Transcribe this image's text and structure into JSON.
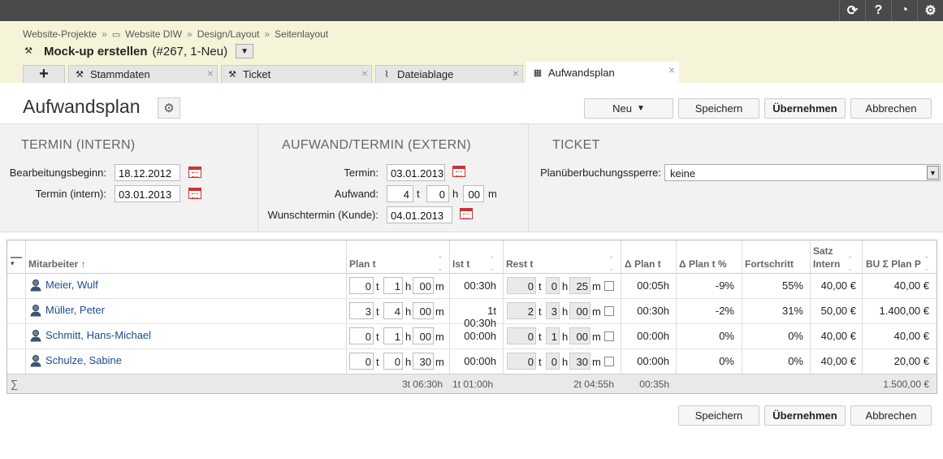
{
  "topbar": {
    "icons": [
      "refresh-icon",
      "help-icon",
      "timer-icon",
      "settings-icon"
    ],
    "help_glyph": "?"
  },
  "breadcrumb": [
    "Website-Projekte",
    "Website DIW",
    "Design/Layout",
    "Seitenlayout"
  ],
  "ticket": {
    "title": "Mock-up erstellen",
    "meta": "(#267, 1-Neu)"
  },
  "tabs": {
    "plus": "+",
    "items": [
      "Stammdaten",
      "Ticket",
      "Dateiablage",
      "Aufwandsplan"
    ],
    "close": "×"
  },
  "page": {
    "title": "Aufwandsplan"
  },
  "buttons": {
    "neu": "Neu",
    "speichern": "Speichern",
    "uebernehmen": "Übernehmen",
    "abbrechen": "Abbrechen"
  },
  "termin_intern": {
    "heading": "TERMIN (INTERN)",
    "bearbeitungsbeginn_label": "Bearbeitungsbeginn:",
    "bearbeitungsbeginn": "18.12.2012",
    "termin_label": "Termin (intern):",
    "termin": "03.01.2013"
  },
  "aufwand_extern": {
    "heading": "AUFWAND/TERMIN (EXTERN)",
    "termin_label": "Termin:",
    "termin": "03.01.2013",
    "aufwand_label": "Aufwand:",
    "aufwand_t": "4",
    "aufwand_h": "0",
    "aufwand_m": "00",
    "wunsch_label": "Wunschtermin (Kunde):",
    "wunsch": "04.01.2013"
  },
  "units": {
    "t": "t",
    "h": "h",
    "m": "m"
  },
  "ticket_panel": {
    "heading": "TICKET",
    "sperre_label": "Planüberbuchungssperre:",
    "sperre_value": "keine"
  },
  "grid": {
    "headers": {
      "mitarbeiter": "Mitarbeiter",
      "plan": "Plan t",
      "ist": "Ist t",
      "rest": "Rest t",
      "dplan": "Δ Plan t",
      "dplanp": "Δ Plan t %",
      "fortschritt": "Fortschritt",
      "satz1": "Satz",
      "satz2": "Intern",
      "bu": "BU Σ Plan P"
    },
    "rows": [
      {
        "name": "Meier, Wulf",
        "plan_t": "0",
        "plan_h": "1",
        "plan_m": "00",
        "ist": "00:30h",
        "rest_t": "0",
        "rest_h": "0",
        "rest_m": "25",
        "dplan": "00:05h",
        "dplanp": "-9%",
        "fortschritt": "55%",
        "satz": "40,00 €",
        "bu": "40,00 €"
      },
      {
        "name": "Müller, Peter",
        "plan_t": "3",
        "plan_h": "4",
        "plan_m": "00",
        "ist": "1t 00:30h",
        "rest_t": "2",
        "rest_h": "3",
        "rest_m": "00",
        "dplan": "00:30h",
        "dplanp": "-2%",
        "fortschritt": "31%",
        "satz": "50,00 €",
        "bu": "1.400,00 €"
      },
      {
        "name": "Schmitt, Hans-Michael",
        "plan_t": "0",
        "plan_h": "1",
        "plan_m": "00",
        "ist": "00:00h",
        "rest_t": "0",
        "rest_h": "1",
        "rest_m": "00",
        "dplan": "00:00h",
        "dplanp": "0%",
        "fortschritt": "0%",
        "satz": "40,00 €",
        "bu": "40,00 €"
      },
      {
        "name": "Schulze, Sabine",
        "plan_t": "0",
        "plan_h": "0",
        "plan_m": "30",
        "ist": "00:00h",
        "rest_t": "0",
        "rest_h": "0",
        "rest_m": "30",
        "dplan": "00:00h",
        "dplanp": "0%",
        "fortschritt": "0%",
        "satz": "40,00 €",
        "bu": "20,00 €"
      }
    ],
    "sum": {
      "symbol": "∑",
      "plan": "3t 06:30h",
      "ist": "1t 01:00h",
      "rest": "2t 04:55h",
      "dplan": "00:35h",
      "bu": "1.500,00 €"
    }
  }
}
